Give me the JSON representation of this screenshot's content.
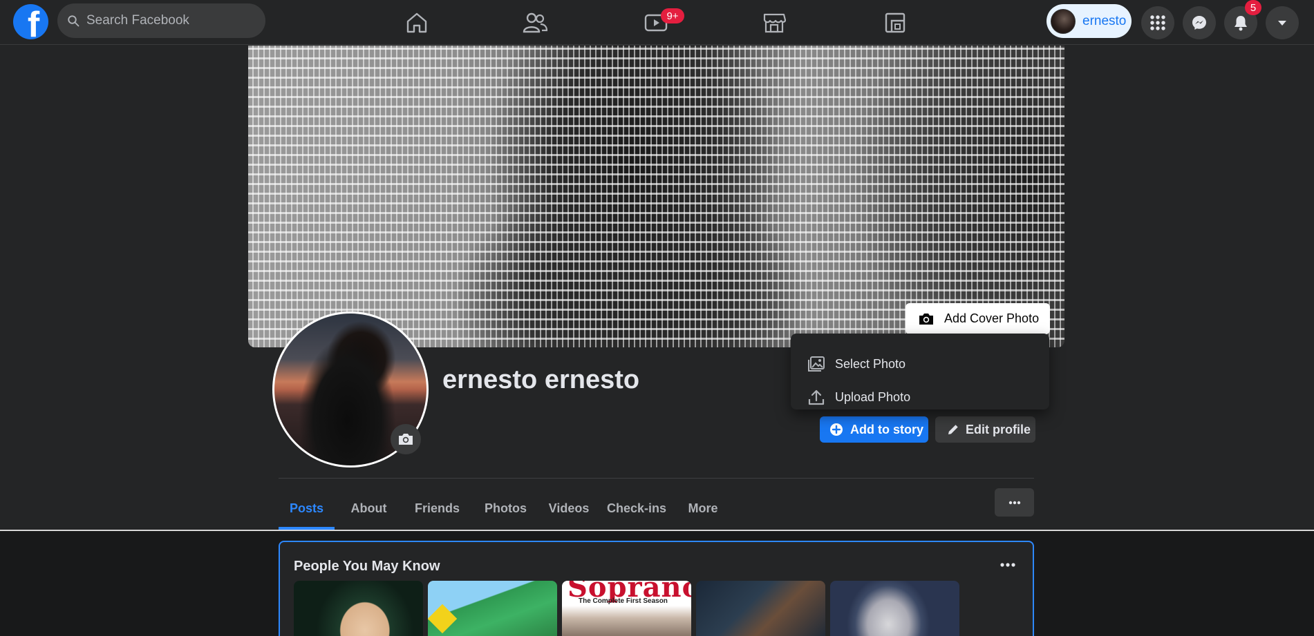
{
  "search": {
    "placeholder": "Search Facebook"
  },
  "nav": {
    "watch_badge": "9+",
    "profile_name": "ernesto",
    "notifications_badge": "5"
  },
  "cover": {
    "add_cover_label": "Add Cover Photo",
    "menu": [
      {
        "label": "Select Photo",
        "icon": "image-icon"
      },
      {
        "label": "Upload Photo",
        "icon": "upload-icon"
      }
    ]
  },
  "profile": {
    "name": "ernesto ernesto",
    "add_story_label": "Add to story",
    "edit_profile_label": "Edit profile"
  },
  "tabs": [
    {
      "label": "Posts",
      "active": true
    },
    {
      "label": "About"
    },
    {
      "label": "Friends"
    },
    {
      "label": "Photos"
    },
    {
      "label": "Videos"
    },
    {
      "label": "Check-ins"
    },
    {
      "label": "More"
    }
  ],
  "pymk": {
    "title": "People You May Know",
    "card3_title": "Sopranos",
    "card3_subtitle": "The Complete First Season"
  },
  "colors": {
    "accent": "#2d88ff",
    "brand": "#1877f2",
    "badge": "#e41e3f",
    "surface": "#242526"
  }
}
